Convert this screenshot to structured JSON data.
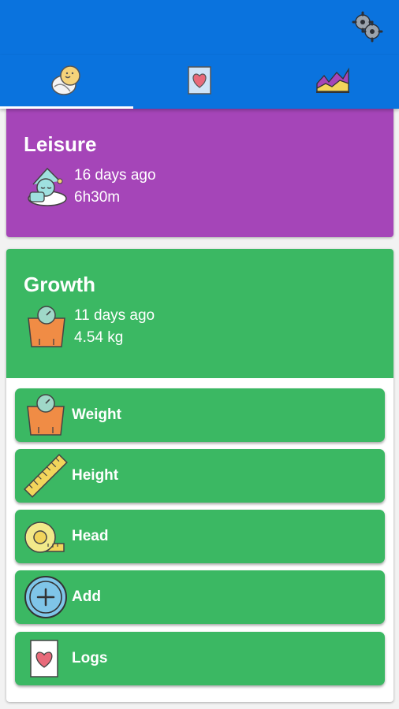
{
  "appbar": {
    "settings_icon": "gear-icon"
  },
  "tabs": [
    {
      "name": "baby",
      "icon": "baby-icon",
      "active": true
    },
    {
      "name": "logs",
      "icon": "heart-card-icon",
      "active": false
    },
    {
      "name": "charts",
      "icon": "area-chart-icon",
      "active": false
    }
  ],
  "leisure": {
    "title": "Leisure",
    "line1": "16 days ago",
    "line2": "6h30m",
    "icon": "sleeping-baby-icon"
  },
  "growth": {
    "title": "Growth",
    "line1": "11 days ago",
    "line2": "4.54 kg",
    "icon": "weight-scale-icon",
    "actions": [
      {
        "label": "Weight",
        "icon": "weight-scale-icon"
      },
      {
        "label": "Height",
        "icon": "ruler-icon"
      },
      {
        "label": "Head",
        "icon": "measuring-tape-icon"
      },
      {
        "label": "Add",
        "icon": "plus-circle-icon"
      },
      {
        "label": "Logs",
        "icon": "heart-card-icon"
      }
    ]
  },
  "colors": {
    "primary": "#0a73de",
    "leisure": "#a545b8",
    "growth": "#3bb863"
  }
}
